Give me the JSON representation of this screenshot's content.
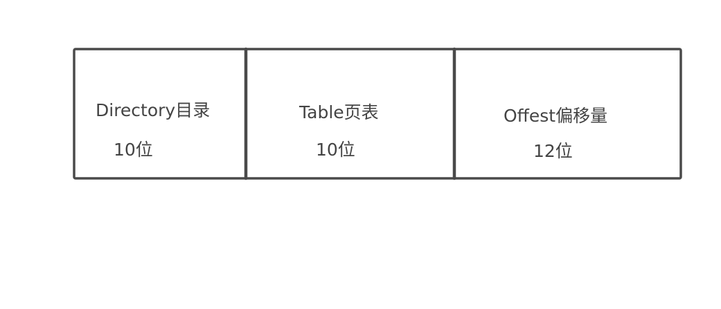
{
  "segments": [
    {
      "name": "Directory目录",
      "bits": "10位"
    },
    {
      "name": "Table页表",
      "bits": "10位"
    },
    {
      "name": "Offest偏移量",
      "bits": "12位"
    }
  ],
  "colors": {
    "stroke": "#4a4a4a",
    "text": "#444444",
    "background": "#ffffff"
  }
}
